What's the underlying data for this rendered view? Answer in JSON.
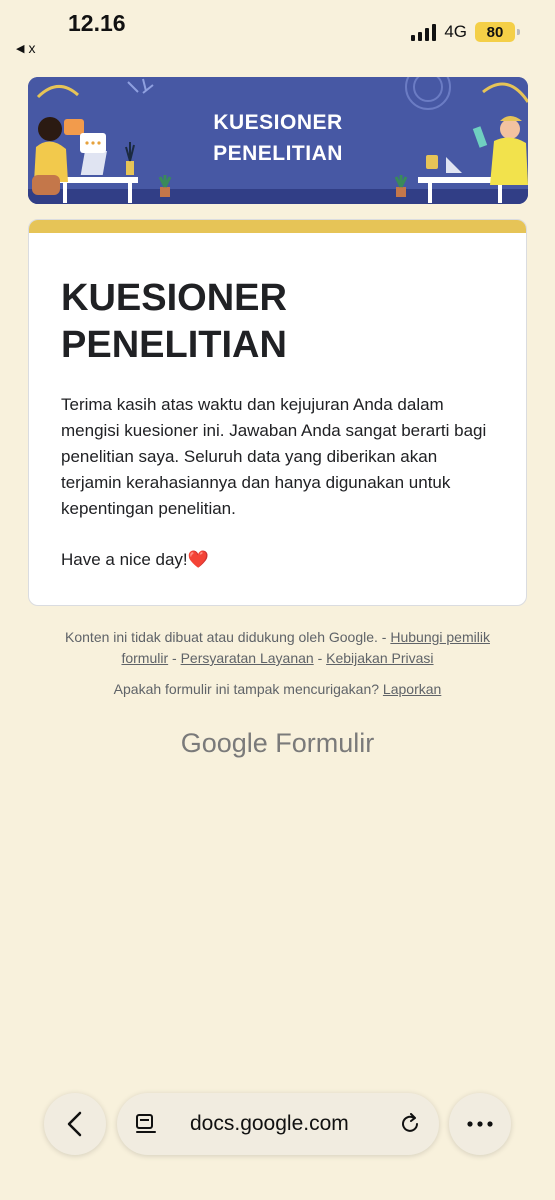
{
  "status_bar": {
    "time": "12.16",
    "back_app_label": "x",
    "network": "4G",
    "battery": "80"
  },
  "banner": {
    "title_line1": "KUESIONER",
    "title_line2": "PENELITIAN"
  },
  "form": {
    "title": "KUESIONER PENELITIAN",
    "description": "Terima kasih atas waktu dan kejujuran Anda dalam mengisi kuesioner ini. Jawaban Anda sangat berarti bagi penelitian saya. Seluruh data yang diberikan akan terjamin kerahasiannya dan hanya digunakan untuk kepentingan penelitian.",
    "greeting": "Have a nice day!❤️",
    "accent_color": "#e6c457"
  },
  "footer": {
    "disclaimer": "Konten ini tidak dibuat atau didukung oleh Google. -",
    "contact_owner": "Hubungi pemilik formulir",
    "sep1": "-",
    "terms": "Persyaratan Layanan",
    "sep2": "-",
    "privacy": "Kebijakan Privasi",
    "report_question": "Apakah formulir ini tampak mencurigakan?",
    "report_link": "Laporkan",
    "brand_google": "Google",
    "brand_forms": "Formulir"
  },
  "browser": {
    "url": "docs.google.com",
    "back_icon": "chevron-left-icon",
    "page_icon": "page-menu-icon",
    "reload_icon": "reload-icon",
    "more_icon": "more-icon"
  }
}
